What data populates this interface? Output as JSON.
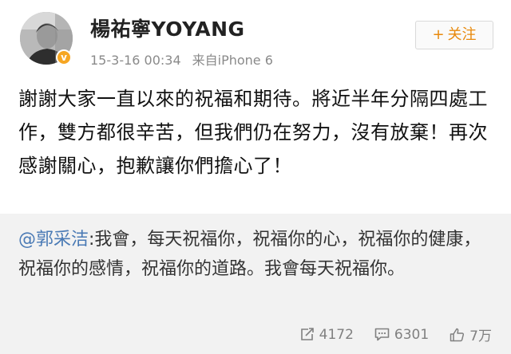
{
  "user": {
    "name": "楊祐寧YOYANG",
    "verified_badge": "v",
    "timestamp": "15-3-16 00:34",
    "source": "来自iPhone 6"
  },
  "follow_button": {
    "icon": "+",
    "label": "关注",
    "accent_color": "#e8890c"
  },
  "post": {
    "text": "謝謝大家一直以來的祝福和期待。將近半年分隔四處工作，雙方都很辛苦，但我們仍在努力，沒有放棄！再次感謝關心，抱歉讓你們擔心了！"
  },
  "repost": {
    "author": "@郭采洁",
    "text": ":我會，每天祝福你，祝福你的心，祝福你的健康，祝福你的感情，祝福你的道路。我會每天祝福你。"
  },
  "stats": {
    "reposts": "4172",
    "comments": "6301",
    "likes": "7万",
    "icons": [
      "repost-icon",
      "comment-icon",
      "like-icon"
    ]
  }
}
